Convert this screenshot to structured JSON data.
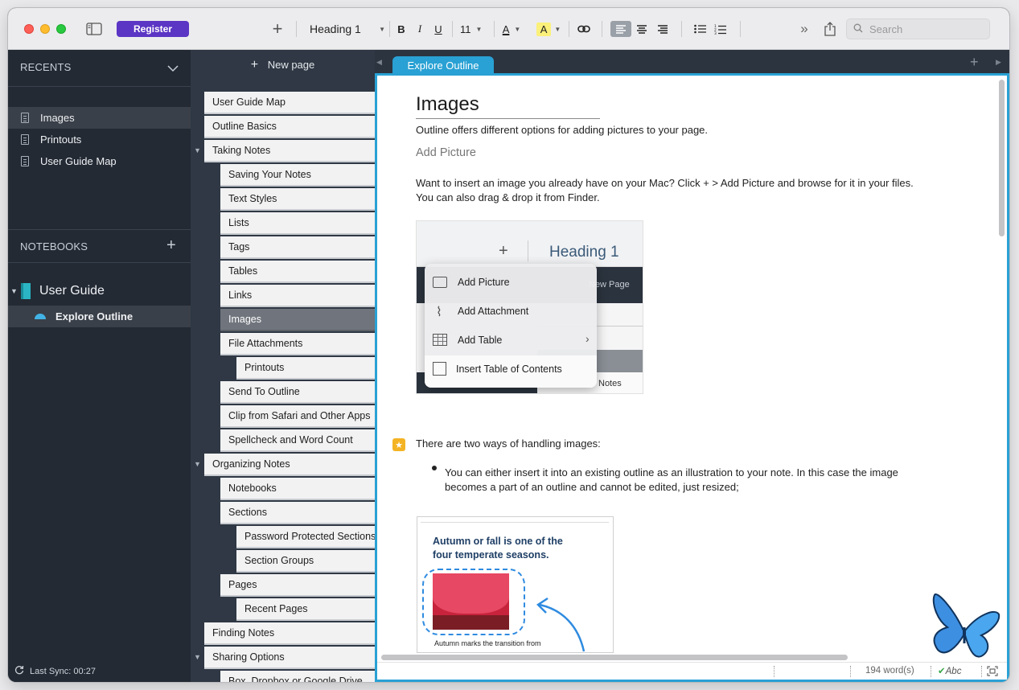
{
  "toolbar": {
    "register_label": "Register",
    "heading_style": "Heading 1",
    "bold": "B",
    "italic": "I",
    "underline": "U",
    "font_size": "11",
    "font_color_label": "A",
    "highlight_label": "A",
    "search_placeholder": "Search",
    "colors": {
      "register_bg": "#5b35c4",
      "highlight": "#fbf07a",
      "accent": "#29a1d4"
    }
  },
  "sidebar": {
    "recents_header": "RECENTS",
    "recents": [
      "Images",
      "Printouts",
      "User Guide Map"
    ],
    "notebooks_header": "NOTEBOOKS",
    "notebook_name": "User Guide",
    "section_name": "Explore Outline",
    "last_sync": "Last Sync: 00:27"
  },
  "pages": {
    "new_page_label": "New page",
    "items": [
      {
        "label": "User Guide Map",
        "level": 0
      },
      {
        "label": "Outline Basics",
        "level": 0
      },
      {
        "label": "Taking Notes",
        "level": 0,
        "expanded": true
      },
      {
        "label": "Saving Your Notes",
        "level": 1
      },
      {
        "label": "Text Styles",
        "level": 1
      },
      {
        "label": "Lists",
        "level": 1
      },
      {
        "label": "Tags",
        "level": 1
      },
      {
        "label": "Tables",
        "level": 1
      },
      {
        "label": "Links",
        "level": 1
      },
      {
        "label": "Images",
        "level": 1,
        "selected": true
      },
      {
        "label": "File Attachments",
        "level": 1
      },
      {
        "label": "Printouts",
        "level": 2
      },
      {
        "label": "Send To Outline",
        "level": 1
      },
      {
        "label": "Clip from Safari and Other Apps",
        "level": 1
      },
      {
        "label": "Spellcheck and Word Count",
        "level": 1
      },
      {
        "label": "Organizing Notes",
        "level": 0,
        "expanded": true
      },
      {
        "label": "Notebooks",
        "level": 1
      },
      {
        "label": "Sections",
        "level": 1
      },
      {
        "label": "Password Protected Sections",
        "level": 2
      },
      {
        "label": "Section Groups",
        "level": 2
      },
      {
        "label": "Pages",
        "level": 1
      },
      {
        "label": "Recent Pages",
        "level": 2
      },
      {
        "label": "Finding Notes",
        "level": 0
      },
      {
        "label": "Sharing Options",
        "level": 0,
        "expanded": true
      },
      {
        "label": "Box, Dropbox or Google Drive",
        "level": 1
      }
    ]
  },
  "tab": {
    "title": "Explore Outline"
  },
  "document": {
    "title": "Images",
    "intro": "Outline offers different options for adding pictures to your page.",
    "subheading": "Add Picture",
    "para1": "Want to insert an image you already have on your Mac? Click + > Add Picture and browse for it in your files. You can also drag & drop it from Finder.",
    "screenshot_menu": {
      "toolbar_heading": "Heading 1",
      "bg_new_page": "New Page",
      "bg_notes": "Notes",
      "items": [
        "Add Picture",
        "Add Attachment",
        "Add Table",
        "Insert Table of Contents"
      ]
    },
    "tag_line": "There are two ways of handling images:",
    "bullet1": "You can either insert it into an existing outline as an illustration to your note. In this case the image becomes a part of an outline and cannot be edited, just resized;",
    "screenshot_autumn": {
      "heading": "Autumn or fall is one of the four temperate seasons.",
      "caption": "Autumn marks the transition from"
    }
  },
  "status": {
    "word_count": "194 word(s)",
    "spellcheck": "Abc"
  }
}
